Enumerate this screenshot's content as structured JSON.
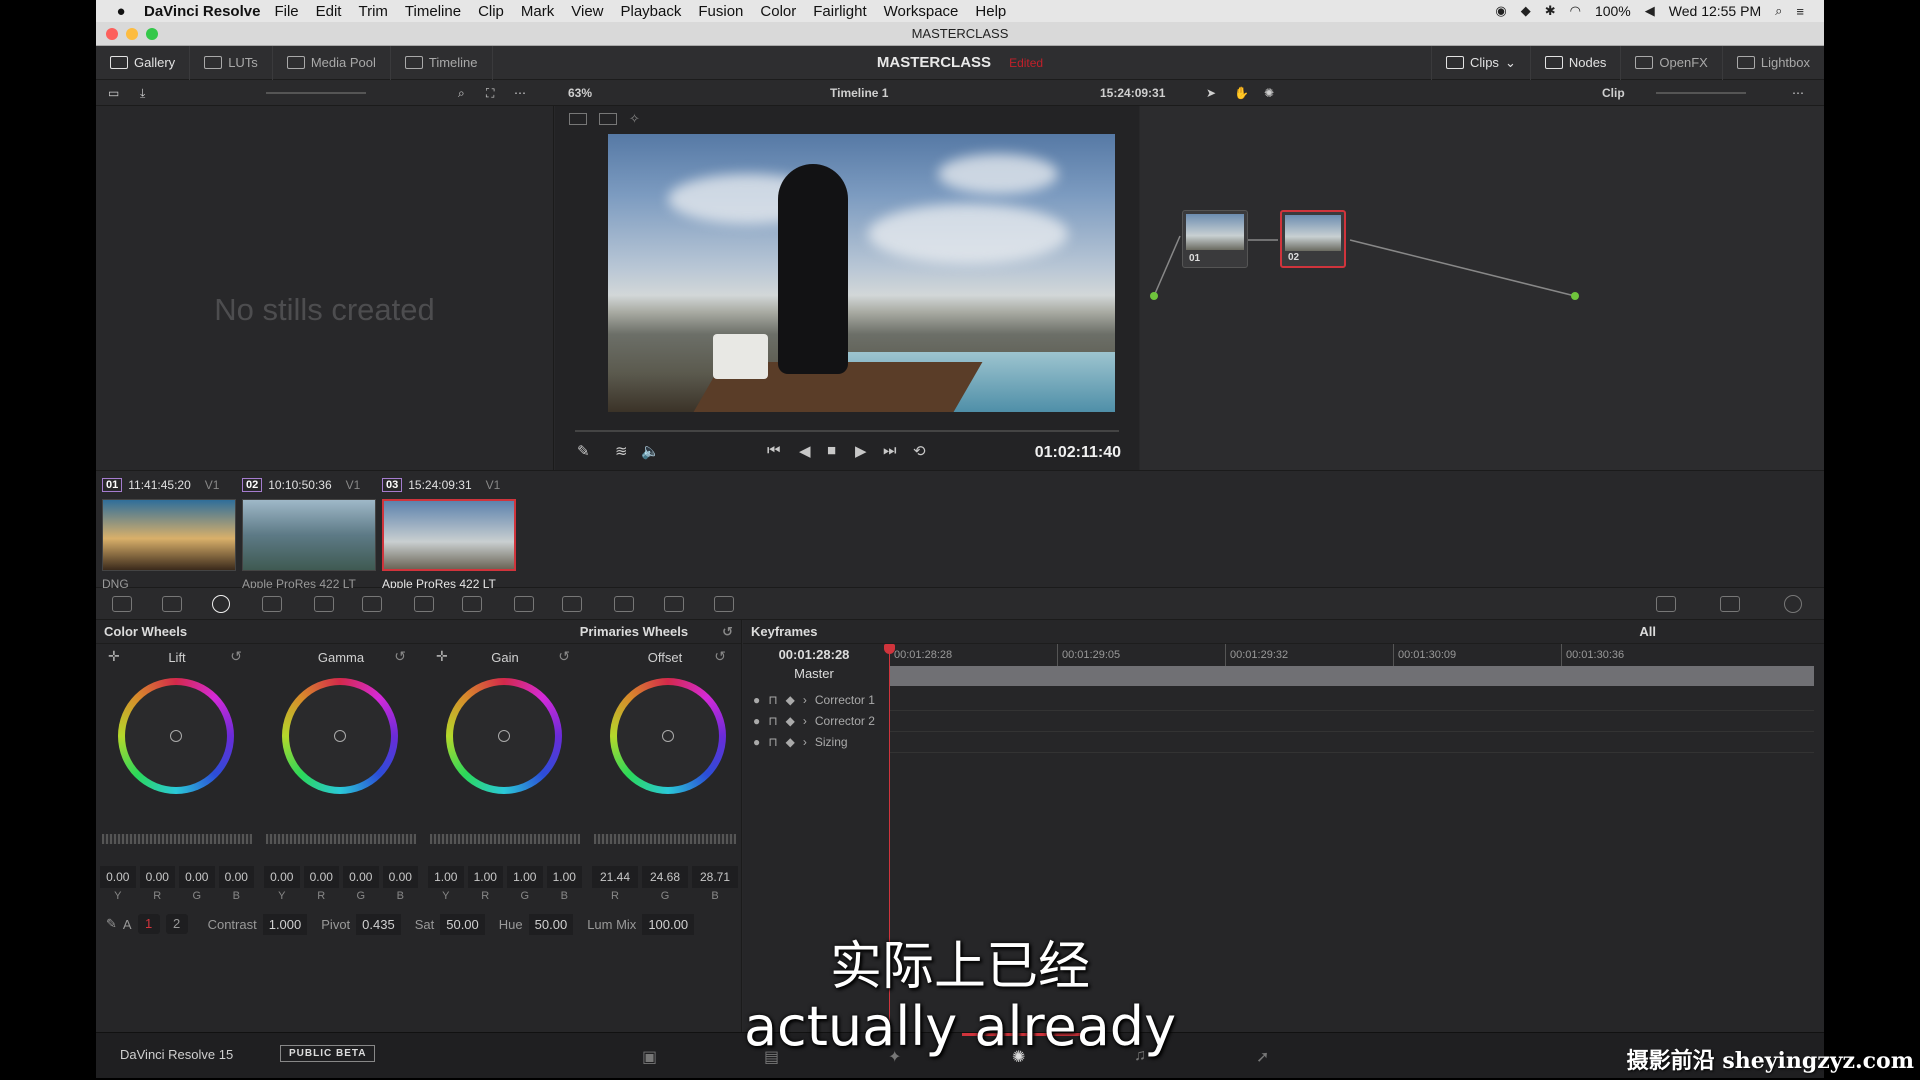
{
  "menubar": {
    "app_name": "DaVinci Resolve",
    "items": [
      "File",
      "Edit",
      "Trim",
      "Timeline",
      "Clip",
      "Mark",
      "View",
      "Playback",
      "Fusion",
      "Color",
      "Fairlight",
      "Workspace",
      "Help"
    ],
    "battery": "100%",
    "clock": "Wed 12:55 PM"
  },
  "window": {
    "title": "MASTERCLASS"
  },
  "toolbar": {
    "left": [
      "Gallery",
      "LUTs",
      "Media Pool",
      "Timeline"
    ],
    "project_name": "MASTERCLASS",
    "project_status": "Edited",
    "right": [
      "Clips",
      "Nodes",
      "OpenFX",
      "Lightbox"
    ]
  },
  "subbar": {
    "zoom": "63%",
    "timeline_name": "Timeline 1",
    "timecode": "15:24:09:31",
    "node_mode": "Clip"
  },
  "gallery": {
    "empty_text": "No stills created"
  },
  "viewer": {
    "timecode": "01:02:11:40"
  },
  "nodes": [
    {
      "label": "01"
    },
    {
      "label": "02"
    }
  ],
  "clips": [
    {
      "num": "01",
      "timecode": "11:41:45:20",
      "track": "V1",
      "codec": "DNG"
    },
    {
      "num": "02",
      "timecode": "10:10:50:36",
      "track": "V1",
      "codec": "Apple ProRes 422 LT"
    },
    {
      "num": "03",
      "timecode": "15:24:09:31",
      "track": "V1",
      "codec": "Apple ProRes 422 LT"
    }
  ],
  "color_wheels": {
    "title": "Color Wheels",
    "mode": "Primaries Wheels",
    "wheels": [
      {
        "label": "Lift",
        "values": [
          "0.00",
          "0.00",
          "0.00",
          "0.00"
        ],
        "channels": [
          "Y",
          "R",
          "G",
          "B"
        ]
      },
      {
        "label": "Gamma",
        "values": [
          "0.00",
          "0.00",
          "0.00",
          "0.00"
        ],
        "channels": [
          "Y",
          "R",
          "G",
          "B"
        ]
      },
      {
        "label": "Gain",
        "values": [
          "1.00",
          "1.00",
          "1.00",
          "1.00"
        ],
        "channels": [
          "Y",
          "R",
          "G",
          "B"
        ]
      },
      {
        "label": "Offset",
        "values": [
          "21.44",
          "24.68",
          "28.71"
        ],
        "channels": [
          "R",
          "G",
          "B"
        ]
      }
    ],
    "pages": [
      "1",
      "2"
    ],
    "adjust": {
      "contrast_label": "Contrast",
      "contrast": "1.000",
      "pivot_label": "Pivot",
      "pivot": "0.435",
      "sat_label": "Sat",
      "sat": "50.00",
      "hue_label": "Hue",
      "hue": "50.00",
      "lummix_label": "Lum Mix",
      "lummix": "100.00"
    }
  },
  "keyframes": {
    "title": "Keyframes",
    "filter": "All",
    "current_tc": "00:01:28:28",
    "ruler": [
      "00:01:28:28",
      "00:01:29:05",
      "00:01:29:32",
      "00:01:30:09",
      "00:01:30:36"
    ],
    "master": "Master",
    "rows": [
      "Corrector 1",
      "Corrector 2",
      "Sizing"
    ]
  },
  "pagebar": {
    "brand": "DaVinci Resolve 15",
    "beta": "PUBLIC BETA"
  },
  "subtitles": {
    "zh": "实际上已经",
    "en": "actually already"
  },
  "watermark": "摄影前沿 sheyingzyz.com",
  "colors": {
    "accent": "#d0343c",
    "panel": "#28282a"
  }
}
